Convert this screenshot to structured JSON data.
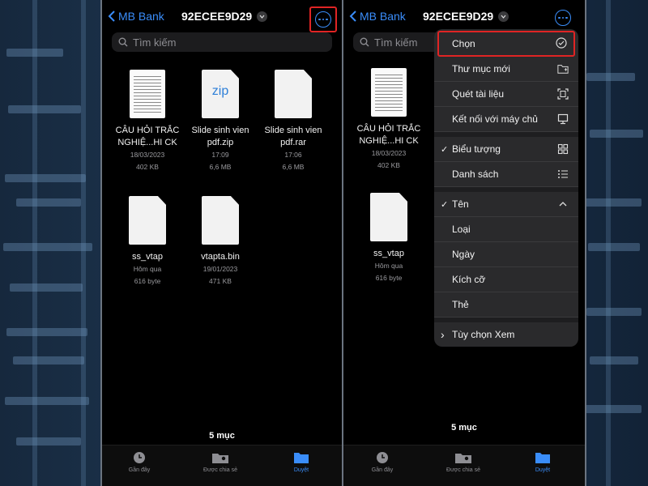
{
  "left_screen": {
    "back_label": "MB Bank",
    "folder_title": "92ECEE9D29",
    "search_placeholder": "Tìm kiếm",
    "files": [
      {
        "name_line1": "CÂU HỎI TRẮC",
        "name_line2": "NGHIỆ...HI CK",
        "date": "18/03/2023",
        "size": "402 KB",
        "kind": "doc"
      },
      {
        "name_line1": "Slide sinh vien",
        "name_line2": "pdf.zip",
        "date": "17:09",
        "size": "6,6 MB",
        "kind": "zip",
        "thumb_label": "zip"
      },
      {
        "name_line1": "Slide sinh vien",
        "name_line2": "pdf.rar",
        "date": "17:06",
        "size": "6,6 MB",
        "kind": "blank"
      },
      {
        "name_line1": "ss_vtap",
        "name_line2": "",
        "date": "Hôm qua",
        "size": "616 byte",
        "kind": "blank"
      },
      {
        "name_line1": "vtapta.bin",
        "name_line2": "",
        "date": "19/01/2023",
        "size": "471 KB",
        "kind": "blank"
      }
    ],
    "count": "5 mục"
  },
  "right_screen": {
    "back_label": "MB Bank",
    "folder_title": "92ECEE9D29",
    "search_placeholder": "Tìm kiếm",
    "files": [
      {
        "name_line1": "CÂU HỎI TRẮC",
        "name_line2": "NGHIỆ...HI CK",
        "date": "18/03/2023",
        "size": "402 KB",
        "kind": "doc"
      },
      {
        "name_line1": "ss_vtap",
        "name_line2": "",
        "date": "Hôm qua",
        "size": "616 byte",
        "kind": "blank"
      }
    ],
    "count": "5 mục",
    "menu": {
      "select": "Chọn",
      "new_folder": "Thư mục mới",
      "scan": "Quét tài liệu",
      "connect": "Kết nối với máy chủ",
      "icons": "Biểu tượng",
      "list": "Danh sách",
      "name": "Tên",
      "kind": "Loại",
      "date": "Ngày",
      "size": "Kích cỡ",
      "tags": "Thẻ",
      "view_options": "Tùy chọn Xem",
      "check_mark": "✓",
      "chevron_right": "›"
    }
  },
  "tabs": {
    "recents": "Gần đây",
    "shared": "Được chia sẻ",
    "browse": "Duyệt"
  },
  "colors": {
    "accent": "#3a8dfa",
    "highlight": "#e02424"
  }
}
